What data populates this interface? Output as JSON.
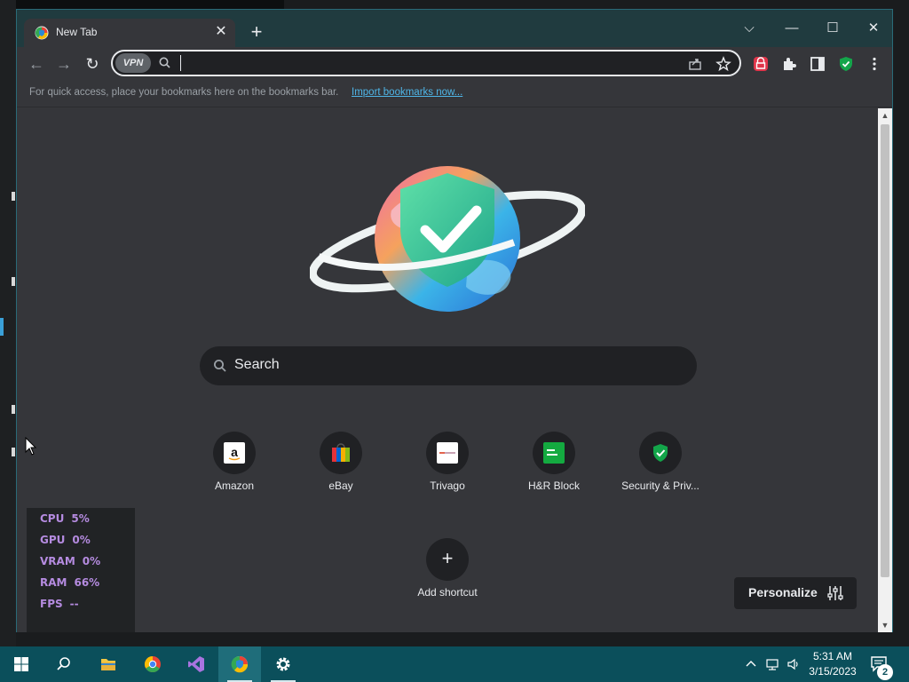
{
  "browser": {
    "tab": {
      "title": "New Tab",
      "close_label": "✕",
      "favicon": "browser-shield-icon"
    },
    "new_tab_label": "+",
    "window_controls": {
      "dropdown": "⌵",
      "minimize": "—",
      "maximize": "☐",
      "close": "✕"
    },
    "toolbar": {
      "back": "←",
      "forward": "→",
      "reload": "↻",
      "vpn_badge": "VPN",
      "omnibox_value": "",
      "omnibox_placeholder": ""
    },
    "bookmarks_bar": {
      "text": "For quick access, place your bookmarks here on the bookmarks bar.",
      "import_link": "Import bookmarks now..."
    }
  },
  "ntp": {
    "search_label": "Search",
    "shortcuts": [
      {
        "label": "Amazon",
        "icon": "amazon-icon",
        "color": "#ffffff"
      },
      {
        "label": "eBay",
        "icon": "ebay-icon",
        "color": "#e53238"
      },
      {
        "label": "Trivago",
        "icon": "trivago-icon",
        "color": "#ffffff"
      },
      {
        "label": "H&R Block",
        "icon": "hr-block-icon",
        "color": "#14aa40"
      },
      {
        "label": "Security & Priv...",
        "icon": "security-shield-icon",
        "color": "#13a54a"
      }
    ],
    "add_shortcut_label": "Add shortcut",
    "add_shortcut_glyph": "+",
    "personalize_label": "Personalize"
  },
  "perf_overlay": [
    {
      "name": "CPU",
      "value": "5%"
    },
    {
      "name": "GPU",
      "value": "0%"
    },
    {
      "name": "VRAM",
      "value": "0%"
    },
    {
      "name": "RAM",
      "value": "66%"
    },
    {
      "name": "FPS",
      "value": "--"
    }
  ],
  "taskbar": {
    "clock_time": "5:31 AM",
    "clock_date": "3/15/2023",
    "notification_count": "2",
    "accent_color": "#0b4f5b"
  }
}
